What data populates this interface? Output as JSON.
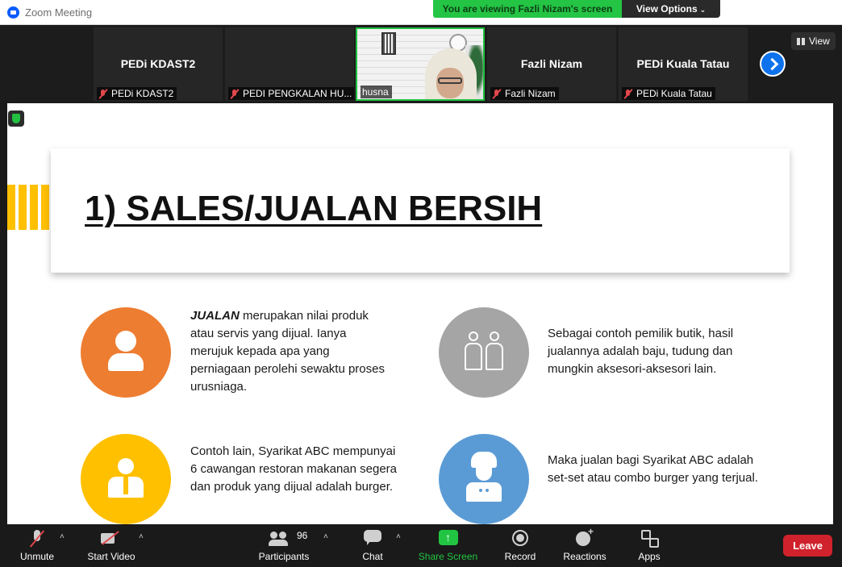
{
  "window": {
    "title": "Zoom Meeting"
  },
  "share_banner": {
    "text": "You are viewing Fazli Nizam's screen",
    "view_options": "View Options"
  },
  "view_button": "View",
  "participants_strip": [
    {
      "name": "PEDi KDAST2",
      "label": "PEDi KDAST2",
      "muted": true
    },
    {
      "name": "",
      "label": "PEDI PENGKALAN HU...",
      "muted": true
    },
    {
      "name": "",
      "label": "husna",
      "muted": false,
      "video": true
    },
    {
      "name": "Fazli Nizam",
      "label": "Fazli Nizam",
      "muted": true
    },
    {
      "name": "PEDi Kuala Tatau",
      "label": "PEDi Kuala Tatau",
      "muted": true
    }
  ],
  "slide": {
    "title": "1) SALES/JUALAN BERSIH",
    "items": [
      {
        "icon": "person-icon",
        "color": "#ed7d31",
        "lead": "JUALAN",
        "text": " merupakan nilai produk atau servis yang dijual. Ianya merujuk kepada apa yang perniagaan perolehi sewaktu proses urusniaga."
      },
      {
        "icon": "dolls-icon",
        "color": "#a5a5a5",
        "text": "Sebagai contoh pemilik butik, hasil jualannya adalah baju, tudung dan mungkin aksesori-aksesori lain."
      },
      {
        "icon": "businessman-icon",
        "color": "#ffc000",
        "text": "Contoh lain, Syarikat ABC mempunyai 6 cawangan restoran makanan segera dan produk yang dijual adalah burger."
      },
      {
        "icon": "chef-icon",
        "color": "#5b9bd5",
        "text": "Maka jualan bagi Syarikat ABC adalah set-set atau combo burger yang terjual."
      }
    ]
  },
  "toolbar": {
    "unmute": "Unmute",
    "start_video": "Start Video",
    "participants": "Participants",
    "participants_count": "96",
    "chat": "Chat",
    "share_screen": "Share Screen",
    "record": "Record",
    "reactions": "Reactions",
    "apps": "Apps",
    "leave": "Leave"
  }
}
